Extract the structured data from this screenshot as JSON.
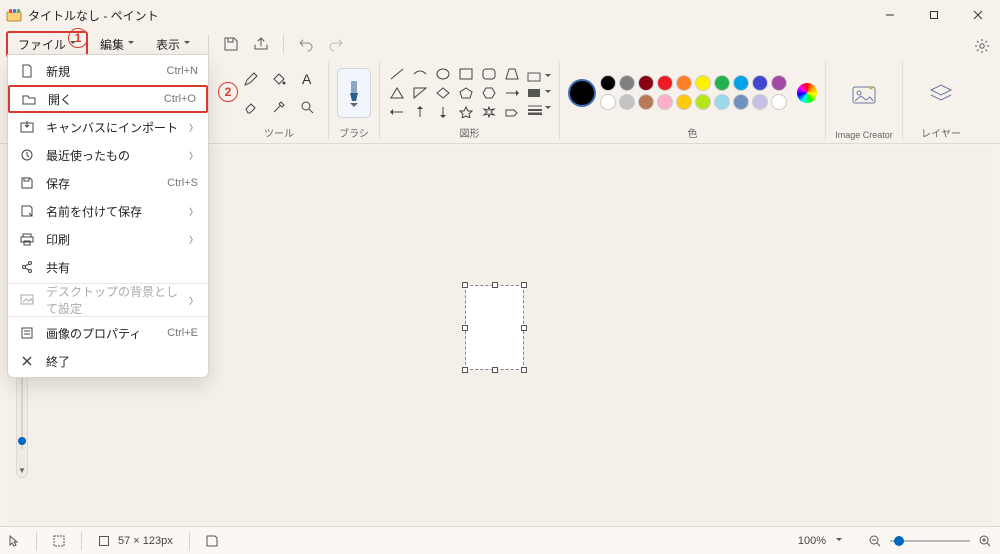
{
  "title": "タイトルなし - ペイント",
  "menubar": {
    "file": "ファイル",
    "edit": "編集",
    "view": "表示"
  },
  "ribbon": {
    "tools_label": "ツール",
    "brush_label": "ブラシ",
    "shapes_label": "図形",
    "colors_label": "色",
    "image_creator_label": "Image Creator",
    "layers_label": "レイヤー"
  },
  "colors": {
    "row1": [
      "#000000",
      "#7f7f7f",
      "#880015",
      "#ed1c24",
      "#ff7f27",
      "#fff200",
      "#22b14c",
      "#00a2e8",
      "#3f48cc",
      "#a349a4"
    ],
    "row2": [
      "#ffffff",
      "#c3c3c3",
      "#b97a57",
      "#ffaec9",
      "#ffc90e",
      "#b5e61d",
      "#99d9ea",
      "#7092be",
      "#c8bfe7",
      "#ffffff"
    ]
  },
  "filemenu": {
    "items": [
      {
        "icon": "file-new",
        "label": "新規",
        "key": "Ctrl+N",
        "sub": false
      },
      {
        "icon": "folder-open",
        "label": "開く",
        "key": "Ctrl+O",
        "sub": false,
        "highlight": true
      },
      {
        "icon": "import",
        "label": "キャンバスにインポート",
        "key": "",
        "sub": true
      },
      {
        "icon": "recent",
        "label": "最近使ったもの",
        "key": "",
        "sub": true
      },
      {
        "icon": "save",
        "label": "保存",
        "key": "Ctrl+S",
        "sub": false
      },
      {
        "icon": "save-as",
        "label": "名前を付けて保存",
        "key": "",
        "sub": true
      },
      {
        "icon": "print",
        "label": "印刷",
        "key": "",
        "sub": true
      },
      {
        "icon": "share",
        "label": "共有",
        "key": "",
        "sub": false
      },
      {
        "icon": "wallpaper",
        "label": "デスクトップの背景として設定",
        "key": "",
        "sub": true,
        "disabled": true
      },
      {
        "icon": "props",
        "label": "画像のプロパティ",
        "key": "Ctrl+E",
        "sub": false
      },
      {
        "icon": "close",
        "label": "終了",
        "key": "",
        "sub": false
      }
    ]
  },
  "annotations": {
    "a1": "1",
    "a2": "2"
  },
  "status": {
    "canvas_size_icon": "□",
    "canvas_size": "57 × 123px",
    "save_status_icon": "🖫",
    "zoom_value": "100%"
  }
}
